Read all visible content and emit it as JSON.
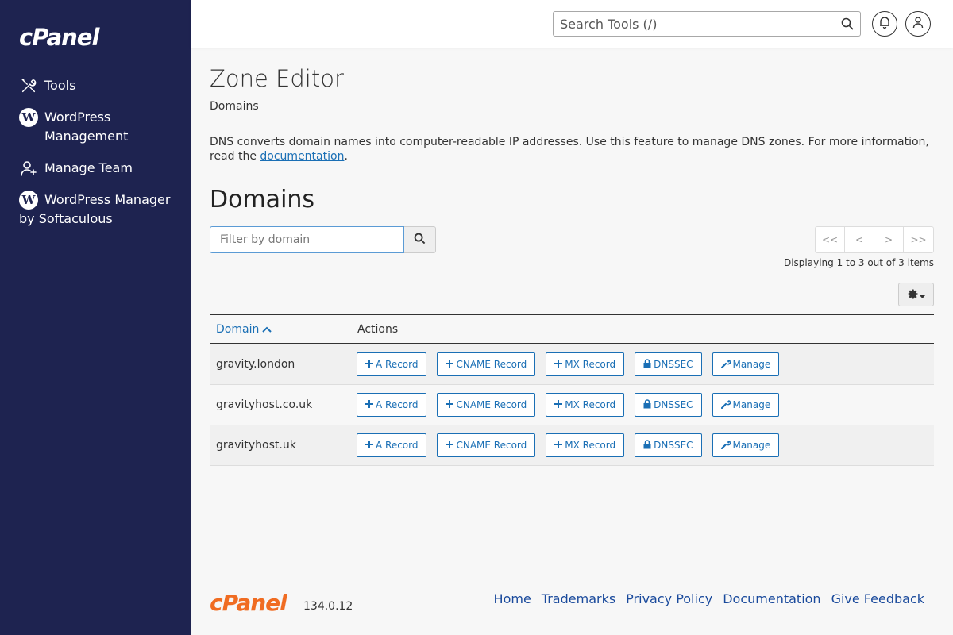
{
  "sidebar": {
    "logo": "cPanel",
    "items": [
      {
        "label": "Tools",
        "icon": "tools-icon"
      },
      {
        "label": "WordPress Management",
        "icon": "wordpress-icon"
      },
      {
        "label": "Manage Team",
        "icon": "manage-team-icon"
      },
      {
        "label": "WordPress Manager by Softaculous",
        "icon": "wordpress-icon"
      }
    ]
  },
  "header": {
    "search_placeholder": "Search Tools (/)"
  },
  "main": {
    "title": "Zone Editor",
    "breadcrumb": "Domains",
    "description": "DNS converts domain names into computer-readable IP addresses. Use this feature to manage DNS zones. For more information, read the",
    "doc_link": "documentation",
    "section_title": "Domains",
    "filter_placeholder": "Filter by domain",
    "pager": [
      "<<",
      "<",
      ">",
      ">>"
    ],
    "pager_info": "Displaying 1 to 3 out of 3 items",
    "columns": {
      "domain": "Domain",
      "actions": "Actions"
    },
    "action_labels": {
      "a": "A Record",
      "cname": "CNAME Record",
      "mx": "MX Record",
      "dnssec": "DNSSEC",
      "manage": "Manage"
    },
    "rows": [
      {
        "domain": "gravity.london"
      },
      {
        "domain": "gravityhost.co.uk"
      },
      {
        "domain": "gravityhost.uk"
      }
    ]
  },
  "footer": {
    "logo": "cPanel",
    "version": "134.0.12",
    "links": [
      "Home",
      "Trademarks",
      "Privacy Policy",
      "Documentation",
      "Give Feedback"
    ]
  },
  "colors": {
    "sidebar": "#1e2350",
    "accent": "#1a6fb5",
    "logo_orange": "#f06c22"
  }
}
